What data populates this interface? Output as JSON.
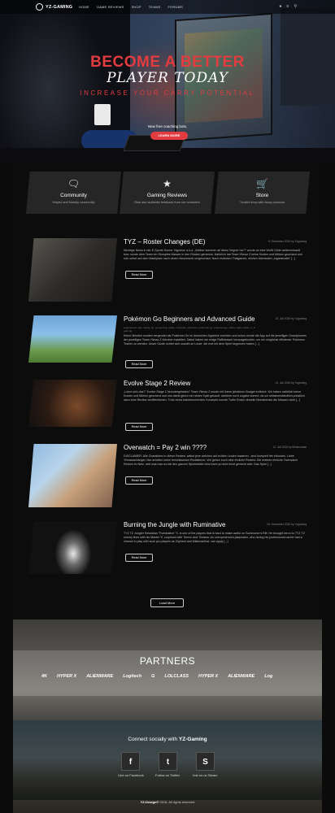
{
  "nav": {
    "logo": "YZ-GAMING",
    "items": [
      "HOME",
      "GAME REVIEWS",
      "SHOP",
      "TEAMS",
      "FORUMS"
    ],
    "icons": [
      "user-icon",
      "menu-icon",
      "search-icon"
    ]
  },
  "hero": {
    "title_line1": "BECOME A BETTER",
    "title_line2": "PLAYER TODAY",
    "subtitle": "INCREASE YOUR CARRY POTENTIAL",
    "note": "New free coaching bots.",
    "button": "LEARN MORE",
    "accent_color": "#e23c41"
  },
  "features": [
    {
      "icon": "chat-icon",
      "title": "Community",
      "desc": "Helpful and friendly community"
    },
    {
      "icon": "star-icon",
      "title": "Gaming Reviews",
      "desc": "Real and authentic feedback from our reviewers"
    },
    {
      "icon": "cart-icon",
      "title": "Store",
      "desc": "Trustful shop with fancy products"
    }
  ],
  "posts": [
    {
      "title": "TYZ – Roster Changes (DE)",
      "date": "5. Dezember 2016 by Yzgaming",
      "meta": "",
      "excerpt": "Wichtige News in der E-Sports Szene: Hyperion a.k.a. „Weiher kommen all diese Gegner her?“ wurde an eine WoW Gilde weiterverkauft bzw. wurde dem Team ein Stumpfes Messer in den Rücken gerammt. Natürlich hat Team Yilmaz Z keine Kosten und Mühen gescheut und sich sofort auf dem Marktplatz nach einem Neuerwerb umgeschaut. Nach endlosen Trialgames, elichen überlauten „ingamecalls“ [...]",
      "button": "Read More"
    },
    {
      "title": "Pokémon Go Beginners and Advanced Guide",
      "date": "19. Juli 2016 by Yzgaming",
      "meta": "augmented, app, candy, go, go gaming, guide, nintendo, pokemon, pokemon go, pokemongo, raichu, tipps, tricks, z, Z gaming",
      "excerpt": "Keine Minuten wurden vergeudet als Pokémon Go im deutschen Appstore erschien und schon wurde die App auf die jeweiligen Smartphones der jeweiligen Team Yilmaz Z Member installiert. Dabei haben wir einige Raffinessen herausgefunden, um ein möglichst effizienter Pokémon Trainer zu werden. Unser Guide richtet sich sowohl an Leute, die erst mit dem Spiel begonnen haben [...]",
      "button": "Read More"
    },
    {
      "title": "Evolve Stage 2 Review",
      "date": "14. Juli 2016 by Yzgaming",
      "meta": "",
      "excerpt": "„Lohnt sich das?“ Evolve Stage 2 heruntergeladen? Team Yilmaz Z wurde mit ihrem jährlichen Budget entlohnt. Wir haben natürlich keine Kosten und Mühen gescheut und uns damit gleich ein neues Spiel gekauft, welches noch zugabe kommt, da wir selbstverständlich pünktlich dazu eine Review veröffentlichen. Trotz eines bahnbrechenden Konzepts konnte Turtle Rocks virtuelle Monsterhatz die Massen nicht [...]",
      "button": "Read More"
    },
    {
      "title": "Overwatch = Pay 2 win ????",
      "date": "11. Juli 2016 by Minimumkai",
      "meta": "",
      "excerpt": "DISCLAIMER: Alle Charaktere in dieser Review, selbst jene welchen auf echten Leuten basieren , sind komplett frei erfunden. Liebe Yilmazianhänger, hier arbeiten keine beschissenen Redakteure. Wir geben euch eine ehrliche Review: Die ersteen ehrliche Overwatch Review im Netz, weil was man so bei den ganzen Spieleseiten liest kann ja nicht ernst gemeint sein. Das Spiel [...]",
      "button": "Read More"
    },
    {
      "title": "Burning the Jungle with Ruminative",
      "date": "25. Dezember 2015 by Yzgaming",
      "meta": "",
      "excerpt": "TYZ TZ Jungler Sebastian \"Ruminative\" S. is one of the players that is hard to make useful on Summoner's Rift. He brought terror to TYZ T2 enemy lines with his Master Yi, surprised with Teemo and Tristana. An unexperienced playmaker, who during his professional career had a chance to play with such pro players as Züphest and Mishmaelhat, can apply [...]",
      "button": "Read More"
    }
  ],
  "load_more": "Load More",
  "partners": {
    "title": "PARTNERS",
    "logos": [
      "4K",
      "HYPER X",
      "ALIENWARE",
      "Logitech",
      "G",
      "LOLCLASS",
      "HYPER X",
      "ALIENWARE",
      "Log"
    ]
  },
  "social": {
    "title_prefix": "Connect socially with",
    "title_brand": "YZ-Gaming",
    "links": [
      {
        "icon": "facebook-icon",
        "glyph": "f",
        "label": "Like on Facebook"
      },
      {
        "icon": "twitter-icon",
        "glyph": "t",
        "label": "Follow on Twitter"
      },
      {
        "icon": "steam-icon",
        "glyph": "S",
        "label": "Join us on Steam"
      }
    ]
  },
  "footer": {
    "brand": "YZ-Design©",
    "text": "2016. All rights reserved"
  }
}
